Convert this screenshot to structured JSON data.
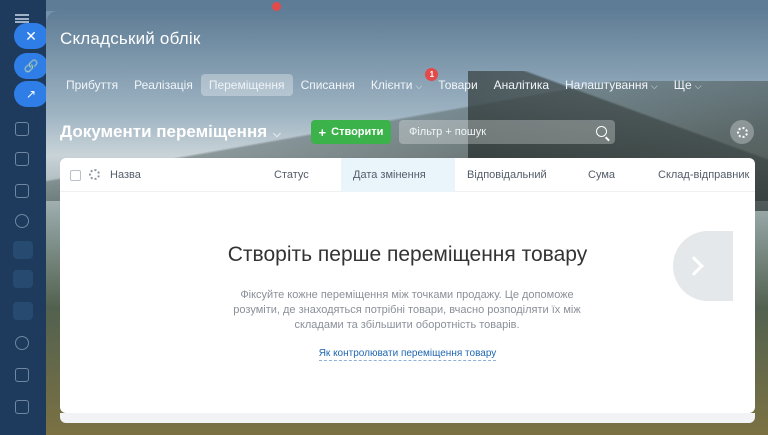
{
  "app": {
    "title": "Складський облік"
  },
  "top_badge": "",
  "tabs": [
    {
      "label": "Прибуття"
    },
    {
      "label": "Реалізація"
    },
    {
      "label": "Переміщення",
      "active": true
    },
    {
      "label": "Списання"
    },
    {
      "label": "Клієнти",
      "badge": "1",
      "dropdown": true
    },
    {
      "label": "Товари"
    },
    {
      "label": "Аналітика"
    },
    {
      "label": "Налаштування",
      "dropdown": true
    },
    {
      "label": "Ще",
      "dropdown": true
    }
  ],
  "toolbar": {
    "page_title": "Документи переміщення",
    "create_label": "Створити",
    "search_placeholder": "Фільтр + пошук"
  },
  "grid": {
    "columns": [
      "Назва",
      "Статус",
      "Дата змінення",
      "Відповідальний",
      "Сума",
      "Склад-відправник"
    ],
    "sorted_column": "Дата змінення"
  },
  "empty_state": {
    "title": "Створіть перше переміщення товару",
    "text": "Фіксуйте кожне переміщення між точками продажу. Це допоможе розуміти, де знаходяться потрібні товари, вчасно розподіляти їх між складами та збільшити оборотність товарів.",
    "link": "Як контролювати переміщення товару"
  },
  "icons": {
    "close": "close-icon",
    "link": "link-icon",
    "external": "external-link-icon",
    "search": "search-icon",
    "settings": "gear-icon",
    "next": "chevron-right-icon"
  },
  "colors": {
    "rail": "#1e3a5c",
    "accent_blue": "#2f7ee8",
    "create_green": "#3bb34a",
    "badge_red": "#e34a4a",
    "link": "#2067b0"
  }
}
